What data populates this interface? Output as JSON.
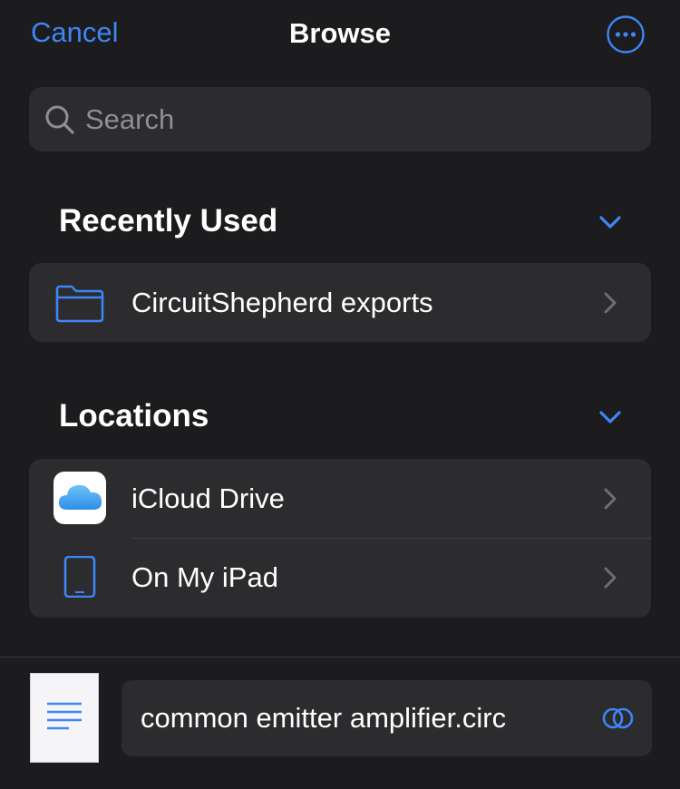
{
  "nav": {
    "cancel_label": "Cancel",
    "title": "Browse",
    "more_icon": "ellipsis-circle-icon"
  },
  "search": {
    "placeholder": "Search",
    "value": ""
  },
  "sections": {
    "recently_used": {
      "title": "Recently Used",
      "toggle_icon": "chevron-down-icon",
      "items": [
        {
          "label": "CircuitShepherd exports",
          "icon": "folder-icon"
        }
      ]
    },
    "locations": {
      "title": "Locations",
      "toggle_icon": "chevron-down-icon",
      "items": [
        {
          "label": "iCloud Drive",
          "icon": "icloud-icon"
        },
        {
          "label": "On My iPad",
          "icon": "ipad-icon"
        }
      ]
    }
  },
  "bottom": {
    "document_icon": "document-icon",
    "filename": "common emitter amplifier.circ",
    "toggle_icon": "circles-toggle-icon"
  },
  "colors": {
    "accent": "#3d86f5",
    "background": "#1c1c1e",
    "cell": "#2c2c2e",
    "secondary_text": "#8e8e93"
  }
}
